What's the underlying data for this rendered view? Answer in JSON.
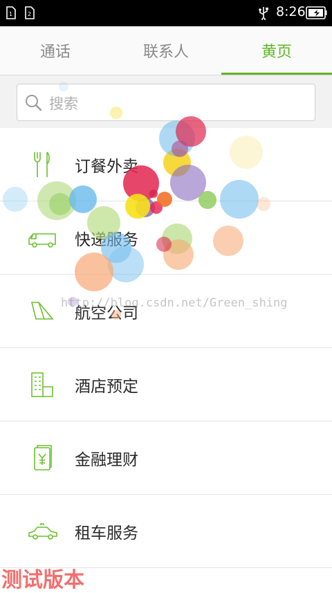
{
  "status_bar": {
    "time": "8:26"
  },
  "tabs": [
    {
      "label": "通话",
      "active": false
    },
    {
      "label": "联系人",
      "active": false
    },
    {
      "label": "黄页",
      "active": true
    }
  ],
  "search": {
    "placeholder": "搜索"
  },
  "categories": [
    {
      "label": "订餐外卖",
      "icon": "fork-knife-icon"
    },
    {
      "label": "快递服务",
      "icon": "delivery-van-icon"
    },
    {
      "label": "航空公司",
      "icon": "airplane-tail-icon"
    },
    {
      "label": "酒店预定",
      "icon": "hotel-building-icon"
    },
    {
      "label": "金融理财",
      "icon": "yuan-card-icon"
    },
    {
      "label": "租车服务",
      "icon": "car-icon"
    }
  ],
  "watermark": "http://blog.csdn.net/Green_shing",
  "footer": {
    "test_version": "测试版本"
  },
  "colors": {
    "accent": "#5fb623",
    "test_label": "#f26f6f"
  }
}
